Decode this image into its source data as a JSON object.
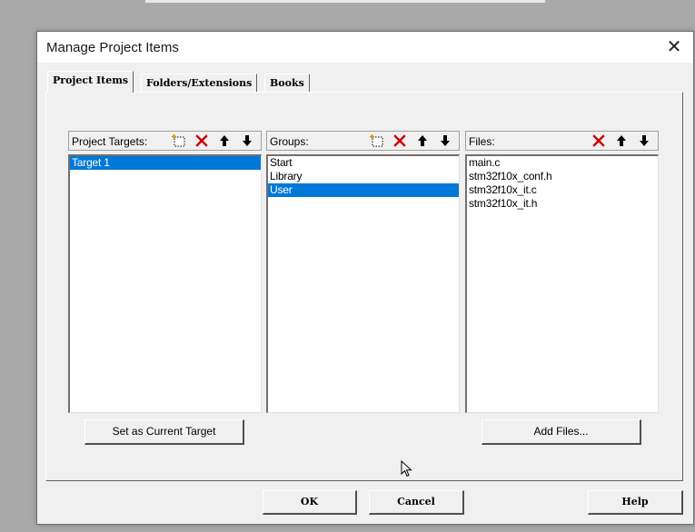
{
  "dialog": {
    "title": "Manage Project Items",
    "close_glyph": "✕"
  },
  "tabs": [
    {
      "label": "Project Items",
      "active": true
    },
    {
      "label": "Folders/Extensions",
      "active": false
    },
    {
      "label": "Books",
      "active": false
    }
  ],
  "targets": {
    "label": "Project Targets:",
    "items": [
      "Target 1"
    ],
    "selected": "Target 1",
    "set_current_button": "Set as Current Target"
  },
  "groups": {
    "label": "Groups:",
    "items": [
      "Start",
      "Library",
      "User"
    ],
    "selected": "User"
  },
  "files": {
    "label": "Files:",
    "items": [
      "main.c",
      "stm32f10x_conf.h",
      "stm32f10x_it.c",
      "stm32f10x_it.h"
    ],
    "add_button": "Add Files..."
  },
  "footer": {
    "ok": "OK",
    "cancel": "Cancel",
    "help": "Help"
  },
  "colors": {
    "selection": "#0078d7",
    "delete_icon": "#cc0000"
  },
  "icons": [
    "new-item-icon",
    "delete-icon",
    "move-up-icon",
    "move-down-icon",
    "close-icon"
  ]
}
